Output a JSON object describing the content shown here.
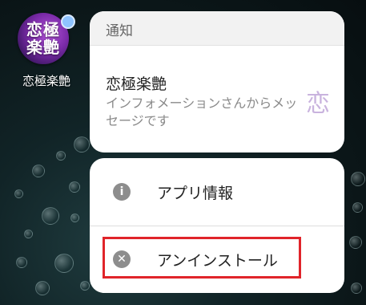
{
  "app": {
    "icon_text_line1": "恋極",
    "icon_text_line2": "楽艶",
    "label": "恋極楽艶",
    "badge_icon": "notification-dot-icon"
  },
  "notification": {
    "header": "通知",
    "title": "恋極楽艶",
    "body": "インフォメーションさんからメッセージです",
    "glyph": "恋"
  },
  "menu": {
    "items": [
      {
        "label": "アプリ情報",
        "icon": "info-icon"
      },
      {
        "label": "アンインストール",
        "icon": "close-circle-icon"
      }
    ]
  },
  "colors": {
    "highlight": "#e0242a",
    "badge": "#8fc3ff",
    "app_icon": "#7a2aa8"
  }
}
